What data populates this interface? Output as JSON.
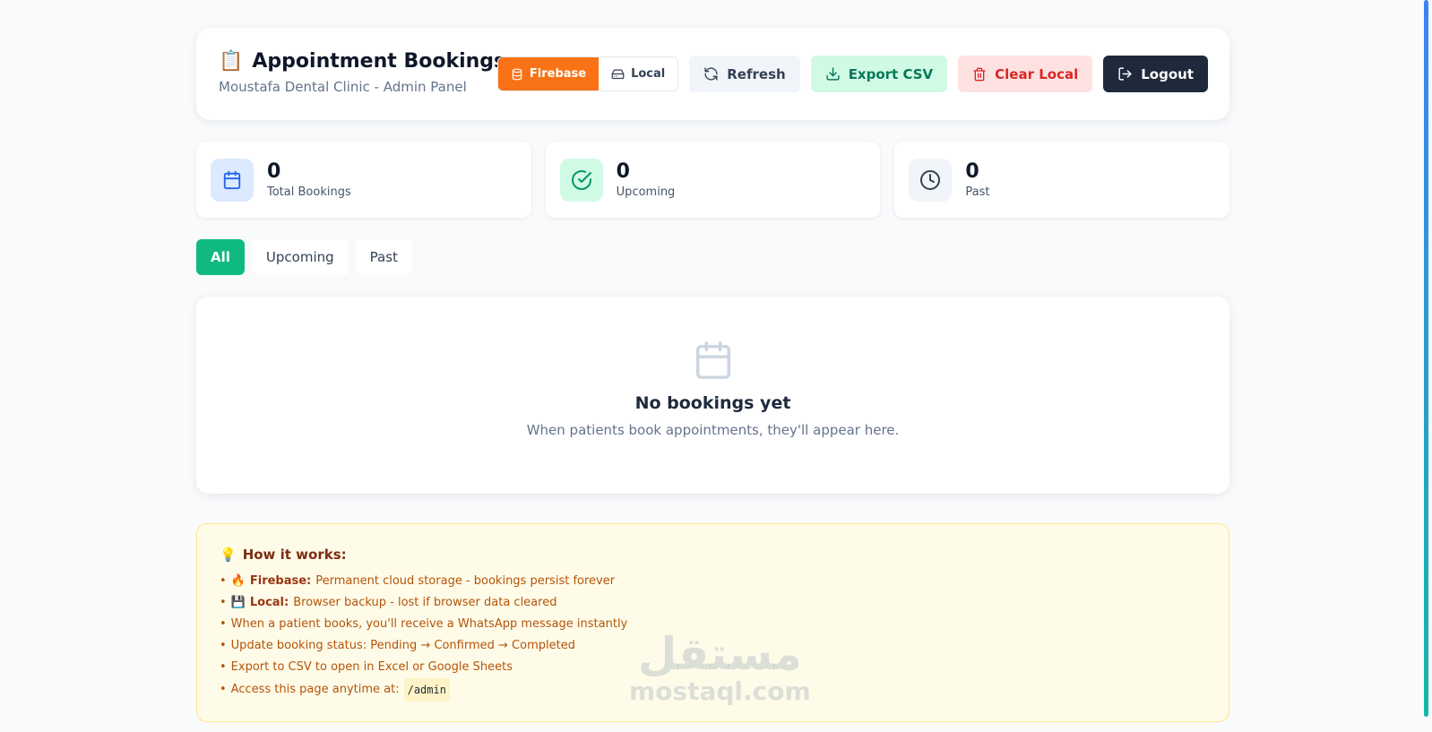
{
  "header": {
    "emoji": "📋",
    "title": "Appointment Bookings",
    "subtitle": "Moustafa Dental Clinic - Admin Panel"
  },
  "storage_toggle": {
    "firebase_label": "Firebase",
    "local_label": "Local",
    "active": "firebase"
  },
  "actions": {
    "refresh_label": "Refresh",
    "export_label": "Export CSV",
    "clear_label": "Clear Local",
    "logout_label": "Logout"
  },
  "stats": [
    {
      "value": "0",
      "label": "Total Bookings",
      "icon": "calendar-icon"
    },
    {
      "value": "0",
      "label": "Upcoming",
      "icon": "check-circle-icon"
    },
    {
      "value": "0",
      "label": "Past",
      "icon": "clock-icon"
    }
  ],
  "filters": [
    {
      "label": "All",
      "active": true
    },
    {
      "label": "Upcoming",
      "active": false
    },
    {
      "label": "Past",
      "active": false
    }
  ],
  "empty_state": {
    "icon": "calendar-icon",
    "title": "No bookings yet",
    "text": "When patients book appointments, they'll appear here."
  },
  "info": {
    "emoji": "💡",
    "title": "How it works:",
    "items": [
      {
        "emoji": "🔥",
        "strong": "Firebase:",
        "text": "Permanent cloud storage - bookings persist forever"
      },
      {
        "emoji": "💾",
        "strong": "Local:",
        "text": "Browser backup - lost if browser data cleared"
      },
      {
        "text": "When a patient books, you'll receive a WhatsApp message instantly"
      },
      {
        "text": "Update booking status: Pending → Confirmed → Completed"
      },
      {
        "text": "Export to CSV to open in Excel or Google Sheets"
      },
      {
        "text": "Access this page anytime at:",
        "code": "/admin"
      }
    ]
  },
  "watermark": {
    "arabic": "مستقل",
    "latin": "mostaql.com"
  },
  "colors": {
    "accent_orange": "#f97316",
    "accent_green": "#10b981",
    "dark": "#1e293b"
  }
}
